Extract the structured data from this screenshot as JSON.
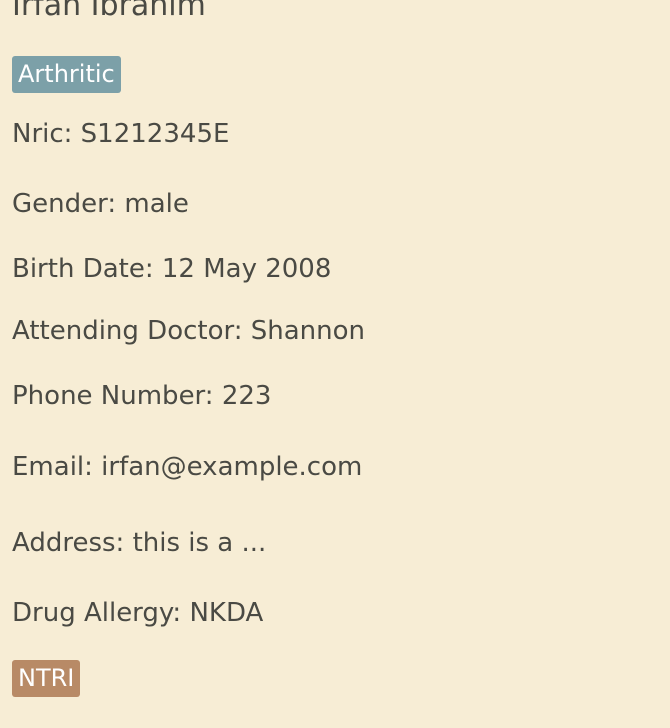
{
  "patient": {
    "name": "Irfan Ibrahim",
    "condition_tag": "Arthritic",
    "nric": "Nric: S1212345E",
    "gender": "Gender: male",
    "birth_date": "Birth Date: 12 May 2008",
    "attending_doctor": "Attending Doctor: Shannon",
    "phone": "Phone Number: 223",
    "email": "Email: irfan@example.com",
    "address": "Address: this is a ...",
    "drug_allergy": "Drug Allergy: NKDA",
    "ward_tag": "NTRI"
  },
  "colors": {
    "background": "#f7edd5",
    "text": "#4a4a44",
    "condition_tag_bg": "#7ca0a8",
    "ward_tag_bg": "#b88a66"
  }
}
